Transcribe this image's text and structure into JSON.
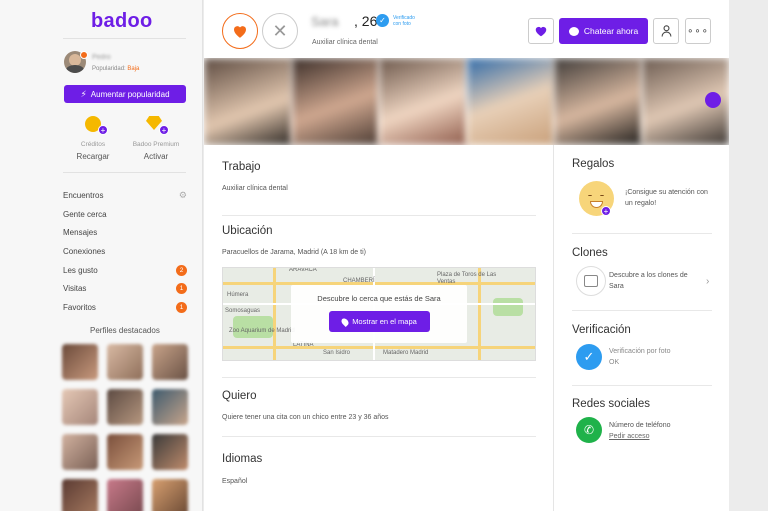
{
  "app": {
    "logo": "badoo"
  },
  "me": {
    "name": "Pedro",
    "popularity_label": "Popularidad:",
    "popularity_value": "Baja"
  },
  "sidebar": {
    "boost_label": "Aumentar popularidad",
    "credits": {
      "title": "Créditos",
      "action": "Recargar"
    },
    "premium": {
      "title": "Badoo Premium",
      "action": "Activar"
    },
    "nav": [
      {
        "label": "Encuentros",
        "badge": "",
        "icon": "filter-icon"
      },
      {
        "label": "Gente cerca",
        "badge": ""
      },
      {
        "label": "Mensajes",
        "badge": ""
      },
      {
        "label": "Conexiones",
        "badge": ""
      },
      {
        "label": "Les gusto",
        "badge": "2"
      },
      {
        "label": "Visitas",
        "badge": "1"
      },
      {
        "label": "Favoritos",
        "badge": "1"
      }
    ],
    "featured_title": "Perfiles destacados"
  },
  "profile": {
    "name": "Sara",
    "age": ", 26",
    "verified_text_1": "Verificado",
    "verified_text_2": "con foto",
    "job": "Auxiliar clínica dental"
  },
  "actions": {
    "chat_label": "Chatear ahora"
  },
  "sections": {
    "work": {
      "title": "Trabajo",
      "text": "Auxiliar clínica dental"
    },
    "location": {
      "title": "Ubicación",
      "text": "Paracuellos de Jarama, Madrid (A 18 km de ti)",
      "map_prompt": "Descubre lo cerca que estás de Sara",
      "map_button": "Mostrar en el mapa",
      "map_labels": [
        "ARAVACA",
        "CHAMBERÍ",
        "Húmera",
        "Somosaguas",
        "Zoo Aquarium de Madrid",
        "LATINA",
        "San Isidro",
        "Matadero Madrid",
        "Plaza de Toros de Las Ventas"
      ]
    },
    "wants": {
      "title": "Quiero",
      "text": "Quiere tener una cita con un chico entre 23 y 36 años"
    },
    "languages": {
      "title": "Idiomas",
      "text": "Español"
    }
  },
  "right": {
    "gifts": {
      "title": "Regalos",
      "text": "¡Consigue su atención con un regalo!"
    },
    "clones": {
      "title": "Clones",
      "text": "Descubre a los clones de Sara"
    },
    "verification": {
      "title": "Verificación",
      "text": "Verificación por foto",
      "status": "OK"
    },
    "social": {
      "title": "Redes sociales",
      "text": "Número de teléfono",
      "link": "Pedir acceso"
    }
  },
  "colors": {
    "brand": "#6e1ee6",
    "accent_orange": "#f36c1a",
    "verified_blue": "#2d9cf0",
    "phone_green": "#1fb24a"
  }
}
